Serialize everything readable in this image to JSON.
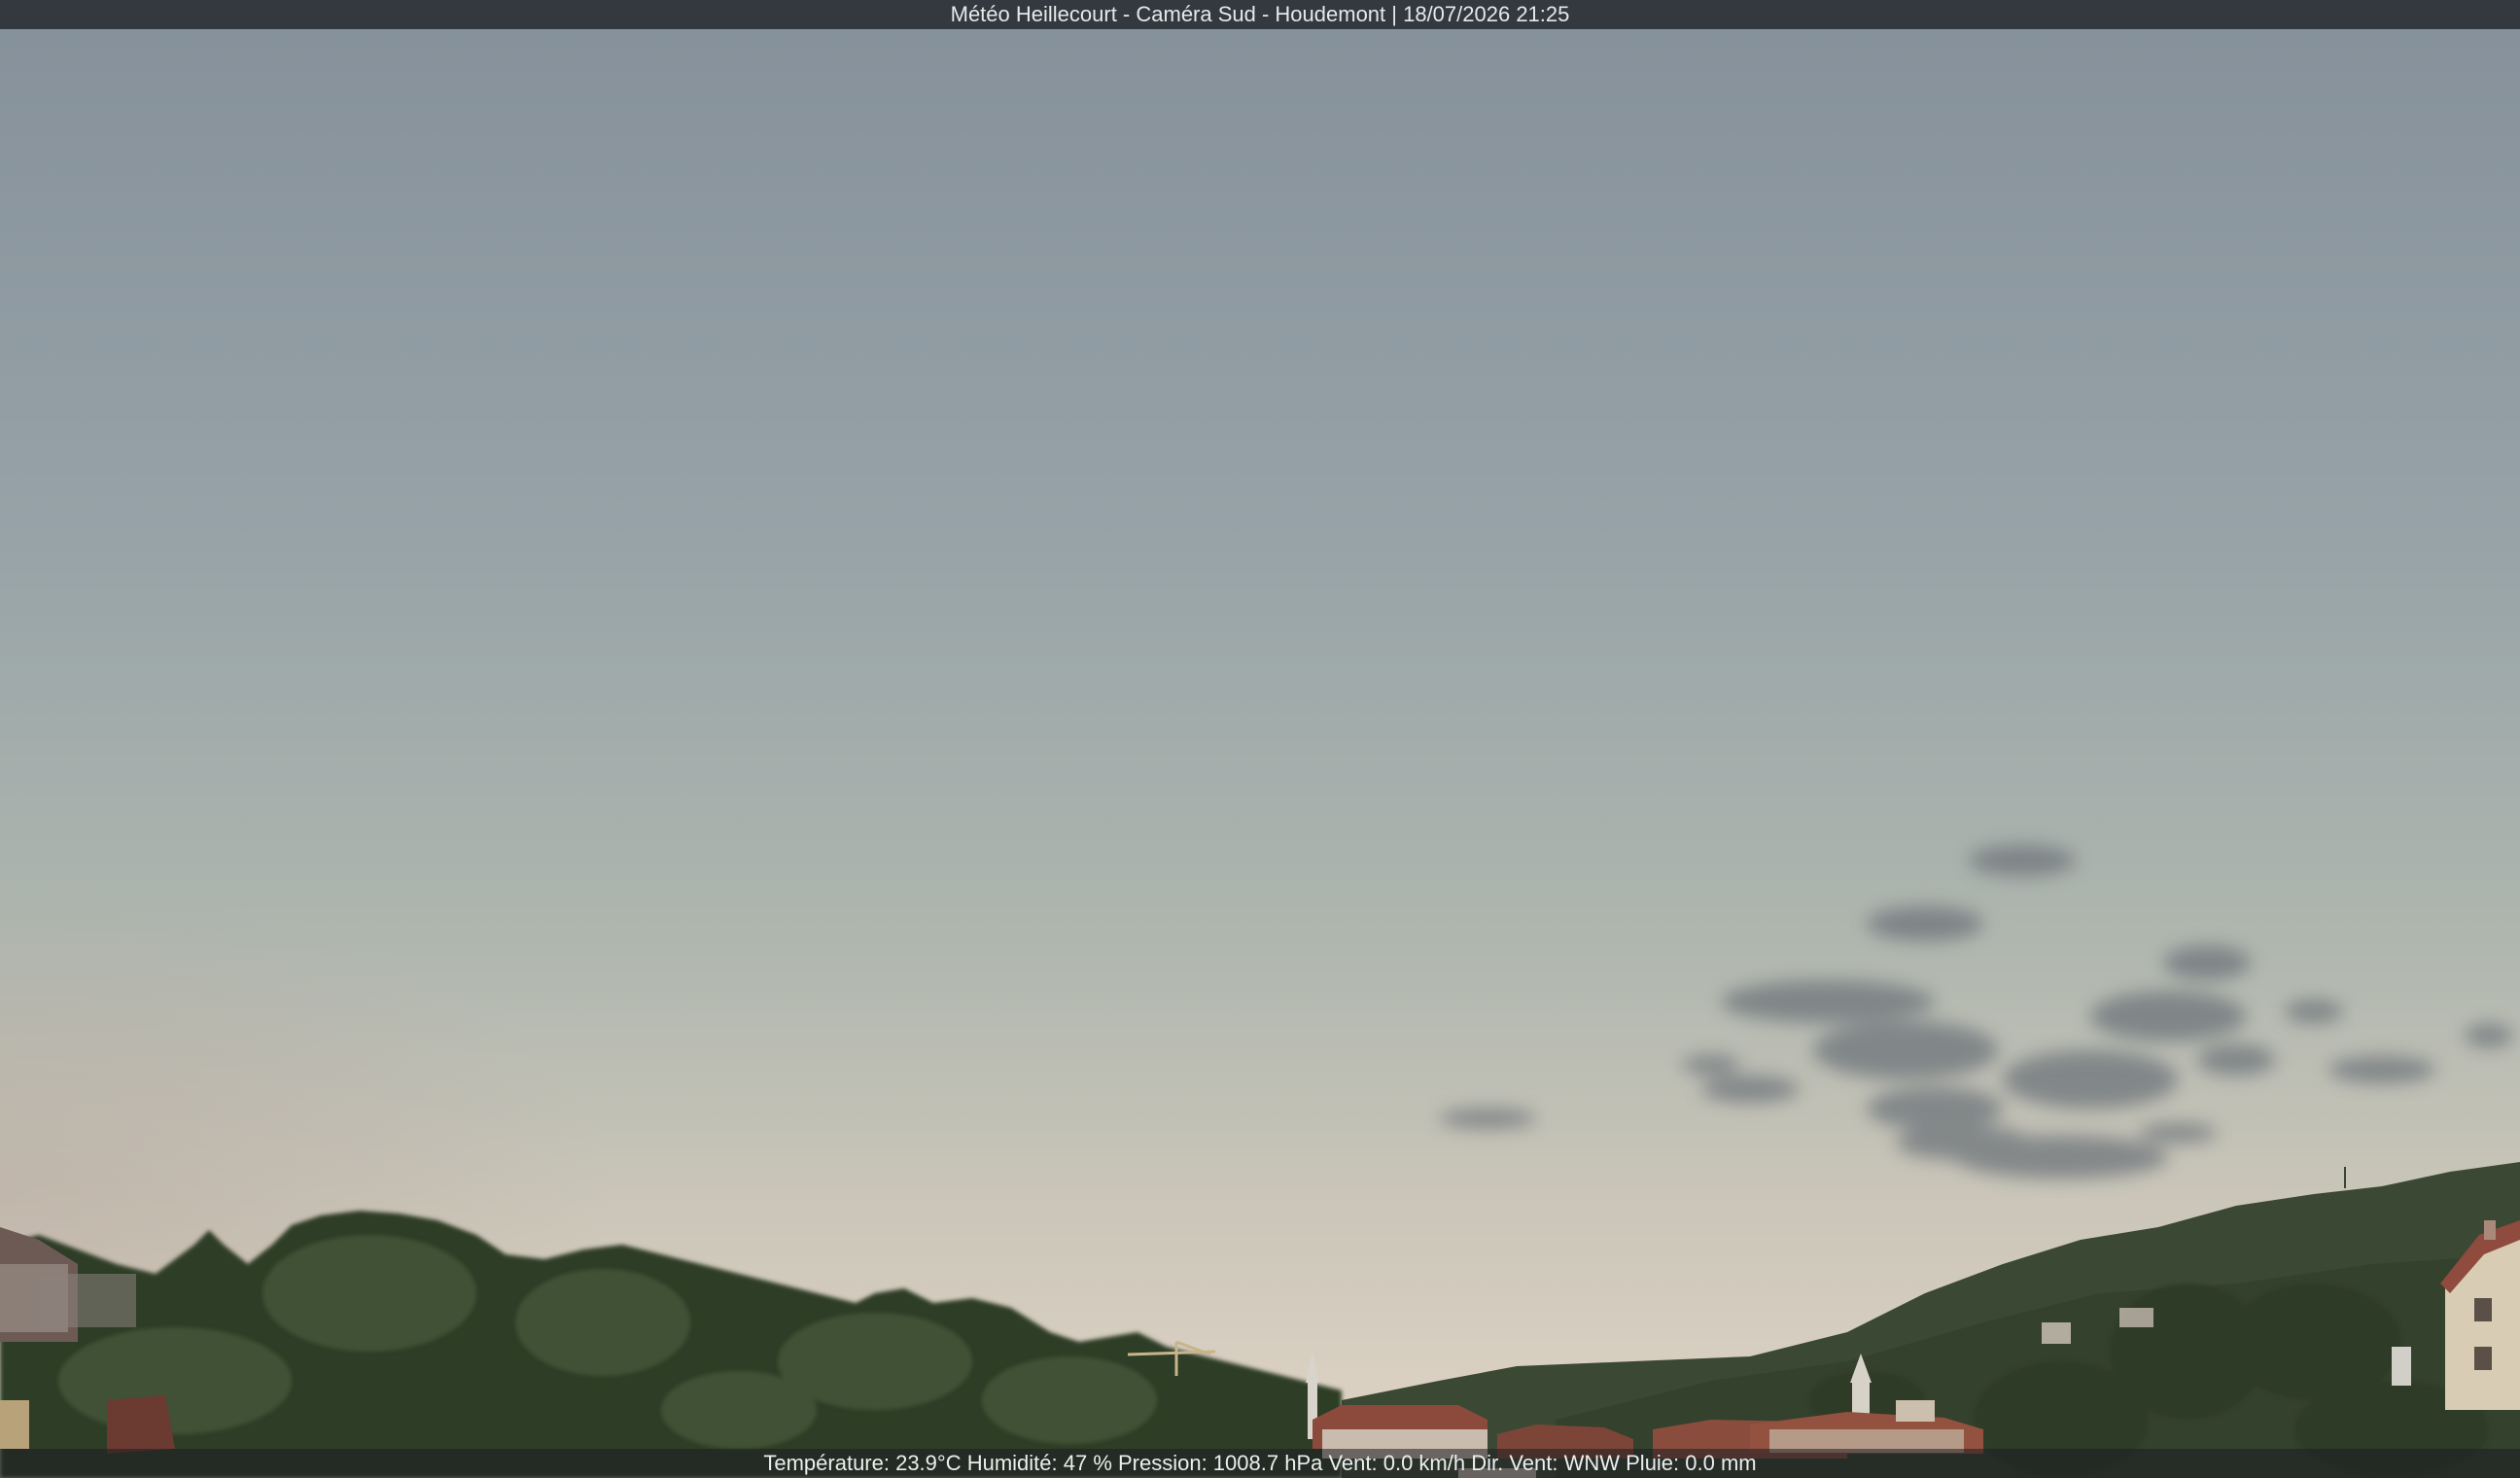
{
  "overlay": {
    "title": "Météo Heillecourt - Caméra Sud - Houdemont | 18/07/2026 21:25",
    "weather_line": "Température: 23.9°C  Humidité: 47 % Pression: 1008.7 hPa Vent: 0.0 km/h Dir. Vent: WNW Pluie: 0.0 mm"
  },
  "colors": {
    "sky_top": "#87929b",
    "sky_mid": "#a4aeaa",
    "sky_horizon": "#d9d1c4",
    "hills": "#3c4a30",
    "trees": "#2f3d28",
    "roofs": "#8a4a3c",
    "clouds": "#6d7278"
  }
}
